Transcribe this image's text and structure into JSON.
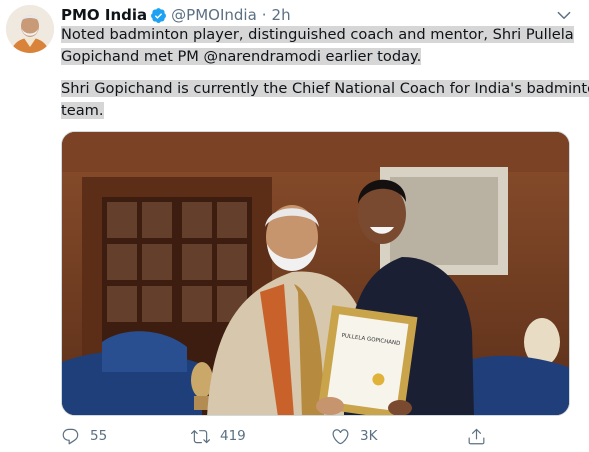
{
  "tweet": {
    "author": {
      "name": "PMO India",
      "handle": "@PMOIndia",
      "verified": true,
      "avatar": "avatar-photo"
    },
    "separator": "·",
    "time": "2h",
    "text": {
      "line1": "Noted badminton player, distinguished coach and mentor, Shri Pullela",
      "line2_prefix": "Gopichand met PM ",
      "line2_mention": "@narendramodi",
      "line2_suffix": " earlier today.",
      "line3": "Shri Gopichand is currently the Chief National Coach for India's badminton",
      "line4": "team."
    },
    "photo": {
      "certificate_name": "PULLELA GOPICHAND"
    },
    "stats": {
      "replies": "55",
      "retweets": "419",
      "likes": "3K"
    }
  },
  "colors": {
    "text": "#0f1419",
    "secondary": "#5b7083",
    "verified": "#1da1f2",
    "highlight": "#d6d6d6"
  },
  "icons": [
    "verified-icon",
    "chevron-down-icon",
    "reply-icon",
    "retweet-icon",
    "like-icon",
    "share-icon"
  ]
}
